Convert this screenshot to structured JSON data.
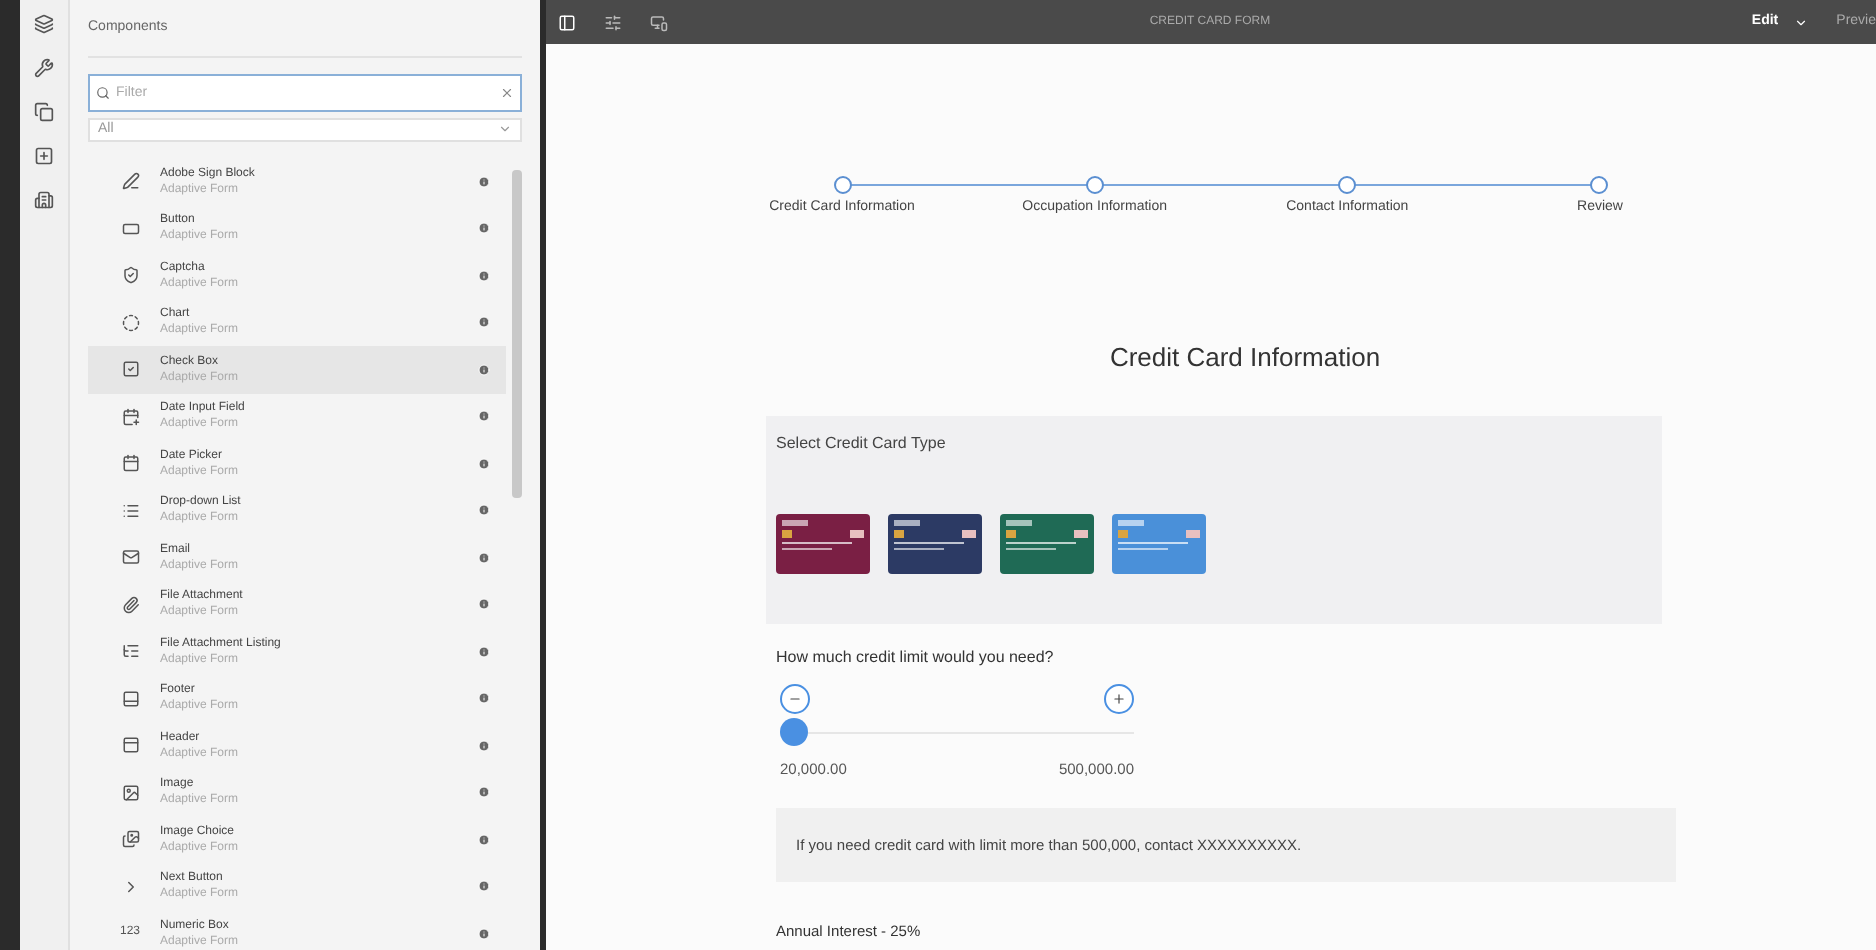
{
  "panel": {
    "title": "Components",
    "filter": {
      "placeholder": "Filter"
    },
    "group_select": {
      "value": "All"
    },
    "items": [
      {
        "name": "Adobe Sign Block",
        "subtitle": "Adaptive Form",
        "selected": false
      },
      {
        "name": "Button",
        "subtitle": "Adaptive Form",
        "selected": false
      },
      {
        "name": "Captcha",
        "subtitle": "Adaptive Form",
        "selected": false
      },
      {
        "name": "Chart",
        "subtitle": "Adaptive Form",
        "selected": false
      },
      {
        "name": "Check Box",
        "subtitle": "Adaptive Form",
        "selected": true
      },
      {
        "name": "Date Input Field",
        "subtitle": "Adaptive Form",
        "selected": false
      },
      {
        "name": "Date Picker",
        "subtitle": "Adaptive Form",
        "selected": false
      },
      {
        "name": "Drop-down List",
        "subtitle": "Adaptive Form",
        "selected": false
      },
      {
        "name": "Email",
        "subtitle": "Adaptive Form",
        "selected": false
      },
      {
        "name": "File Attachment",
        "subtitle": "Adaptive Form",
        "selected": false
      },
      {
        "name": "File Attachment Listing",
        "subtitle": "Adaptive Form",
        "selected": false
      },
      {
        "name": "Footer",
        "subtitle": "Adaptive Form",
        "selected": false
      },
      {
        "name": "Header",
        "subtitle": "Adaptive Form",
        "selected": false
      },
      {
        "name": "Image",
        "subtitle": "Adaptive Form",
        "selected": false
      },
      {
        "name": "Image Choice",
        "subtitle": "Adaptive Form",
        "selected": false
      },
      {
        "name": "Next Button",
        "subtitle": "Adaptive Form",
        "selected": false
      },
      {
        "name": "Numeric Box",
        "subtitle": "Adaptive Form",
        "selected": false,
        "icon_text": "123"
      }
    ]
  },
  "toolbar": {
    "title": "CREDIT CARD FORM",
    "mode": "Edit",
    "preview": "Previe"
  },
  "form": {
    "steps": [
      "Credit Card Information",
      "Occupation Information",
      "Contact Information",
      "Review"
    ],
    "heading": "Credit Card Information",
    "card_type_label": "Select Credit Card Type",
    "cards": [
      {
        "color": "#7a1f44"
      },
      {
        "color": "#2c3a64"
      },
      {
        "color": "#1f6a55"
      },
      {
        "color": "#4a90d9"
      }
    ],
    "limit_question": "How much credit limit would you need?",
    "slider": {
      "level": 0,
      "min_label": "20,000.00",
      "max_label": "500,000.00"
    },
    "notice": "If you need credit card with limit more than 500,000, contact XXXXXXXXXX.",
    "interest": "Annual Interest - 25%"
  }
}
